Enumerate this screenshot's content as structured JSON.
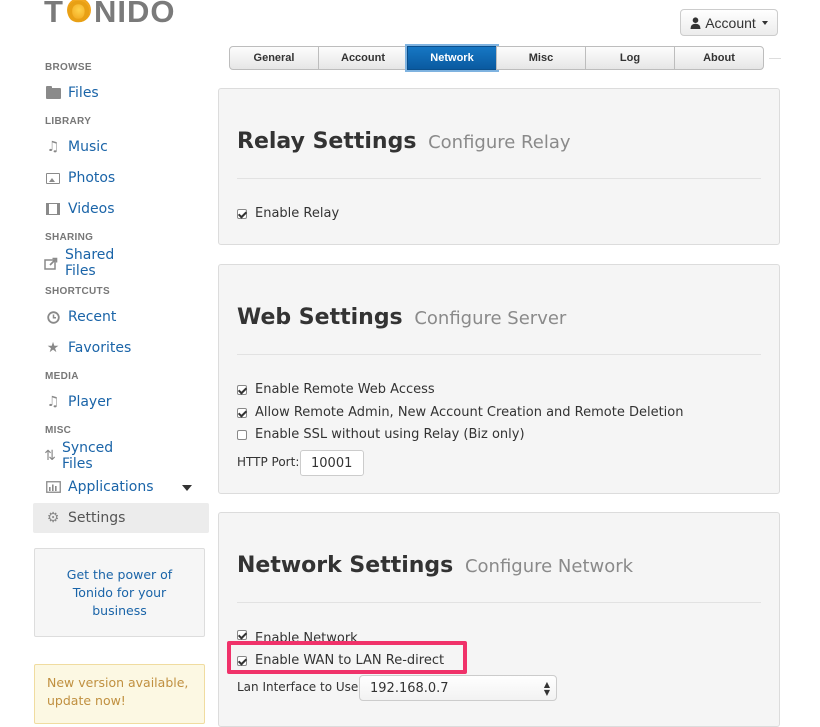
{
  "logo": {
    "text_pre": "T",
    "text_sun": "O",
    "text_post": "NIDO"
  },
  "header": {
    "account_label": "Account",
    "account_icon": "user-icon"
  },
  "tabs": [
    {
      "label": "General"
    },
    {
      "label": "Account"
    },
    {
      "label": "Network",
      "active": true
    },
    {
      "label": "Misc"
    },
    {
      "label": "Log"
    },
    {
      "label": "About"
    }
  ],
  "sidebar": {
    "browse": "BROWSE",
    "files": "Files",
    "library": "LIBRARY",
    "music": "Music",
    "photos": "Photos",
    "videos": "Videos",
    "sharing": "SHARING",
    "shared_files": "Shared Files",
    "shortcuts": "SHORTCUTS",
    "recent": "Recent",
    "favorites": "Favorites",
    "media": "MEDIA",
    "player": "Player",
    "misc": "MISC",
    "synced_files": "Synced Files",
    "applications": "Applications",
    "settings": "Settings"
  },
  "promo": {
    "text": "Get the power of Tonido for your business"
  },
  "update": {
    "text": "New version available, update now!"
  },
  "relay": {
    "title": "Relay Settings",
    "subtitle": "Configure Relay",
    "enable_relay": {
      "label": "Enable Relay",
      "checked": true
    }
  },
  "web": {
    "title": "Web Settings",
    "subtitle": "Configure Server",
    "remote_web": {
      "label": "Enable Remote Web Access",
      "checked": true
    },
    "remote_admin": {
      "label": "Allow Remote Admin, New Account Creation and Remote Deletion",
      "checked": true
    },
    "ssl": {
      "label": "Enable SSL without using Relay (Biz only)",
      "checked": false
    },
    "http_port_label": "HTTP Port:",
    "http_port_value": "10001"
  },
  "network": {
    "title": "Network Settings",
    "subtitle": "Configure Network",
    "enable_network": {
      "label": "Enable Network",
      "checked": true
    },
    "wan_redirect": {
      "label": "Enable WAN to LAN Re-direct",
      "checked": true
    },
    "lan_interface_label": "Lan Interface to Use :",
    "lan_interface_value": "192.168.0.7"
  },
  "colors": {
    "accent": "#0a5aa0",
    "link": "#1a64a8",
    "highlight": "#f0326a"
  }
}
